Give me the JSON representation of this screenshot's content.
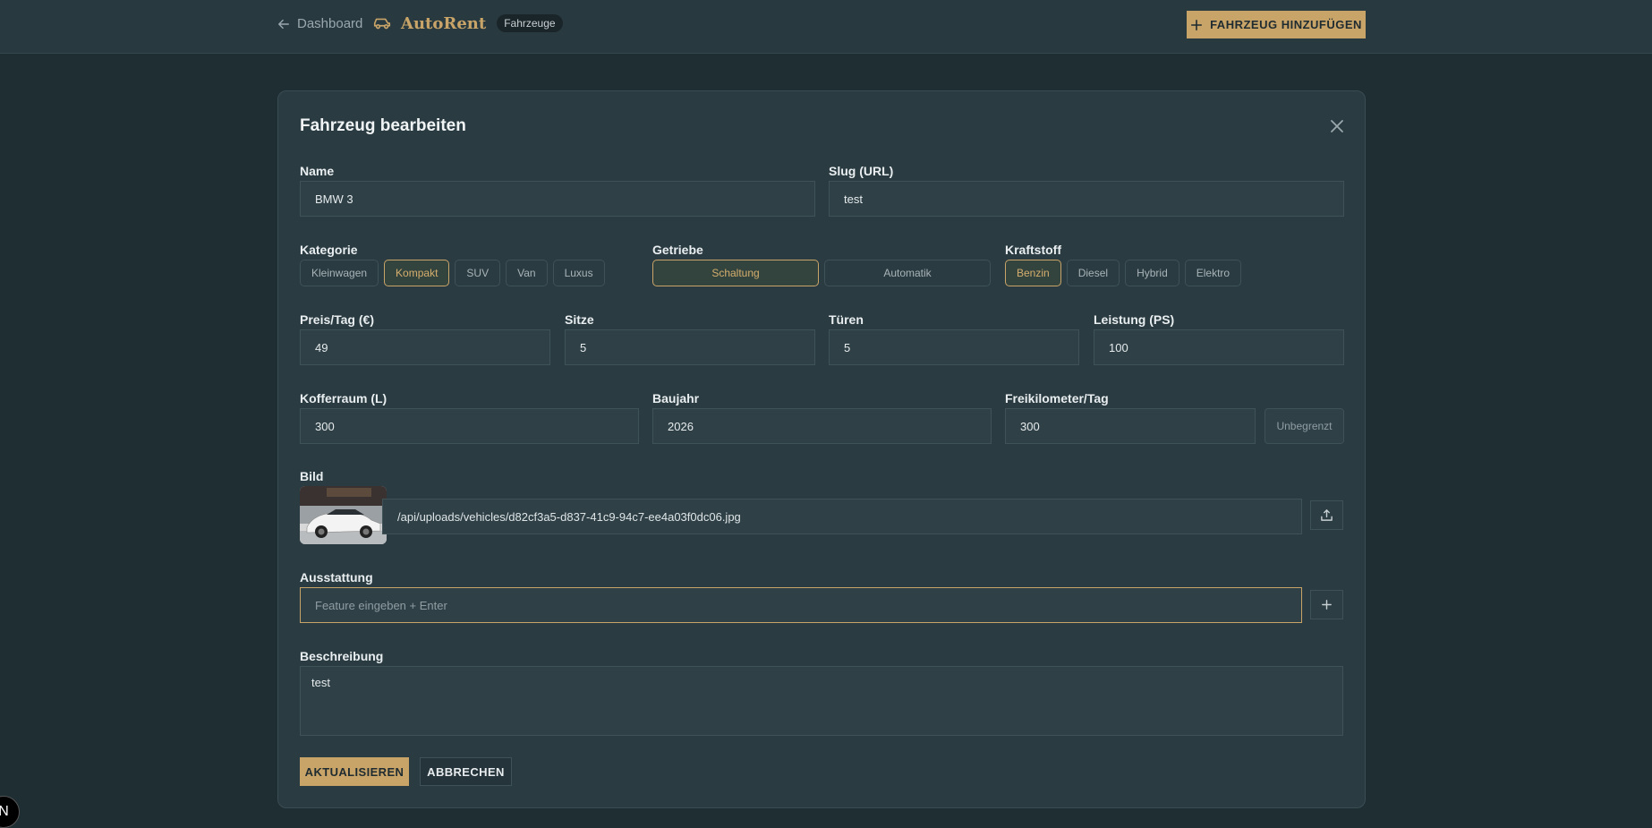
{
  "nav": {
    "back_label": "Dashboard",
    "brand_name": "AutoRent",
    "brand_badge": "Fahrzeuge",
    "add_vehicle_label": "FAHRZEUG HINZUFÜGEN"
  },
  "modal": {
    "title": "Fahrzeug bearbeiten",
    "name": {
      "label": "Name",
      "value": "BMW 3"
    },
    "slug": {
      "label": "Slug (URL)",
      "value": "test"
    },
    "kategorie": {
      "label": "Kategorie",
      "options": [
        "Kleinwagen",
        "Kompakt",
        "SUV",
        "Van",
        "Luxus"
      ],
      "selected": "Kompakt"
    },
    "getriebe": {
      "label": "Getriebe",
      "options": [
        "Schaltung",
        "Automatik"
      ],
      "selected": "Schaltung"
    },
    "kraftstoff": {
      "label": "Kraftstoff",
      "options": [
        "Benzin",
        "Diesel",
        "Hybrid",
        "Elektro"
      ],
      "selected": "Benzin"
    },
    "preis": {
      "label": "Preis/Tag (€)",
      "value": "49"
    },
    "sitze": {
      "label": "Sitze",
      "value": "5"
    },
    "tueren": {
      "label": "Türen",
      "value": "5"
    },
    "leistung": {
      "label": "Leistung (PS)",
      "value": "100"
    },
    "kofferraum": {
      "label": "Kofferraum (L)",
      "value": "300"
    },
    "baujahr": {
      "label": "Baujahr",
      "value": "2026"
    },
    "freikilometer": {
      "label": "Freikilometer/Tag",
      "value": "300",
      "unlimited_label": "Unbegrenzt"
    },
    "bild": {
      "label": "Bild",
      "value": "/api/uploads/vehicles/d82cf3a5-d837-41c9-94c7-ee4a03f0dc06.jpg"
    },
    "ausstattung": {
      "label": "Ausstattung",
      "placeholder": "Feature eingeben + Enter"
    },
    "beschreibung": {
      "label": "Beschreibung",
      "value": "test"
    },
    "submit_label": "AKTUALISIEREN",
    "cancel_label": "ABBRECHEN"
  },
  "dev_badge": "N",
  "colors": {
    "accent": "#c9a468",
    "background": "#1f2e33",
    "panel": "#2a3b41"
  }
}
